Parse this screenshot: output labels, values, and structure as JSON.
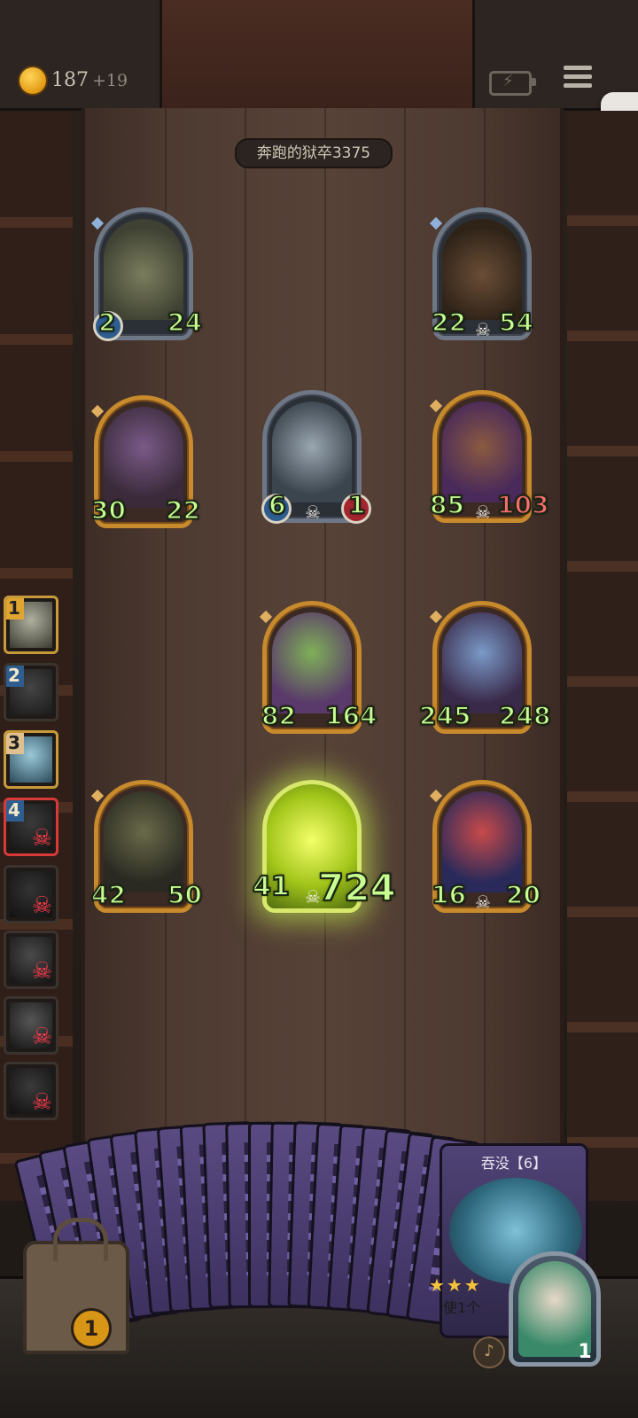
{
  "topbar": {
    "coins": "187",
    "coins_gain": "+19"
  },
  "opponent_name": "奔跑的狱卒3375",
  "board": {
    "cards": [
      {
        "id": "c1",
        "frame": "silver",
        "left": "2",
        "right": "24",
        "skull": false
      },
      {
        "id": "c2",
        "frame": "silver",
        "left": "22",
        "right": "54",
        "skull": true
      },
      {
        "id": "c3",
        "frame": "gold",
        "left": "30",
        "right": "22",
        "skull": false
      },
      {
        "id": "c4",
        "frame": "silver",
        "left": "6",
        "right": "1",
        "skull": true
      },
      {
        "id": "c5",
        "frame": "gold",
        "left": "85",
        "right": "103",
        "skull": true
      },
      {
        "id": "c6",
        "frame": "gold",
        "left": "82",
        "right": "164",
        "skull": false
      },
      {
        "id": "c7",
        "frame": "gold",
        "left": "245",
        "right": "248",
        "skull": false
      },
      {
        "id": "c8",
        "frame": "gold",
        "left": "42",
        "right": "50",
        "skull": false
      },
      {
        "id": "c9",
        "frame": "glow",
        "left": "41",
        "right": "724",
        "skull": true
      },
      {
        "id": "c10",
        "frame": "gold",
        "left": "16",
        "right": "20",
        "skull": true
      }
    ]
  },
  "queue": [
    {
      "num": "1",
      "dead": false
    },
    {
      "num": "2",
      "dead": false
    },
    {
      "num": "3",
      "dead": false
    },
    {
      "num": "4",
      "dead": true,
      "active": true
    },
    {
      "num": "",
      "dead": true
    },
    {
      "num": "",
      "dead": true
    },
    {
      "num": "",
      "dead": true
    },
    {
      "num": "",
      "dead": true
    }
  ],
  "hand": {
    "featured_title": "吞没【6】",
    "featured_hint": "使1个",
    "stars": "★★★"
  },
  "chest_count": "1",
  "hero_life": "1",
  "colors": {
    "stat_green": "#c8ff92",
    "gold_frame": "#c78a2c",
    "silver_frame": "#6e7786",
    "skull_red": "#ff3b4a"
  }
}
